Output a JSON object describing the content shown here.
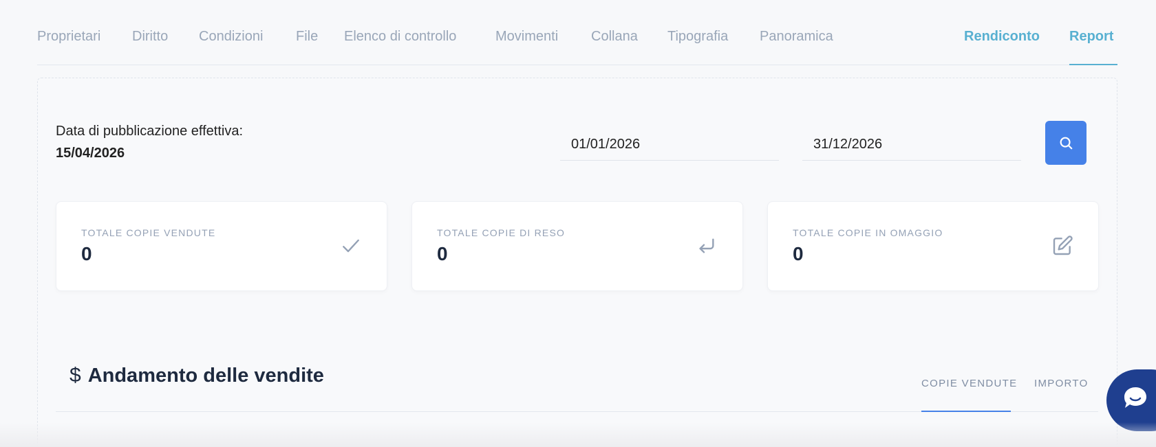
{
  "nav": {
    "tabs": [
      "Proprietari",
      "Diritto",
      "Condizioni",
      "File",
      "Elenco di controllo",
      "Movimenti",
      "Collana",
      "Tipografia",
      "Panoramica"
    ],
    "right_tabs": [
      "Rendiconto",
      "Report"
    ],
    "active": "Report"
  },
  "publication": {
    "label": "Data di pubblicazione effettiva:",
    "date": "15/04/2026"
  },
  "filters": {
    "from_date": "01/01/2026",
    "to_date": "31/12/2026"
  },
  "stats": [
    {
      "label": "TOTALE COPIE VENDUTE",
      "value": "0",
      "icon": "check-icon"
    },
    {
      "label": "TOTALE COPIE DI RESO",
      "value": "0",
      "icon": "return-icon"
    },
    {
      "label": "TOTALE COPIE IN OMAGGIO",
      "value": "0",
      "icon": "edit-icon"
    }
  ],
  "sales": {
    "title": "Andamento delle vendite",
    "icon": "dollar-icon",
    "tabs": [
      "COPIE VENDUTE",
      "IMPORTO"
    ],
    "active_tab": "COPIE VENDUTE"
  },
  "colors": {
    "accent": "#58b0d1",
    "primary": "#4581e8",
    "chat": "#1f3f8f"
  }
}
